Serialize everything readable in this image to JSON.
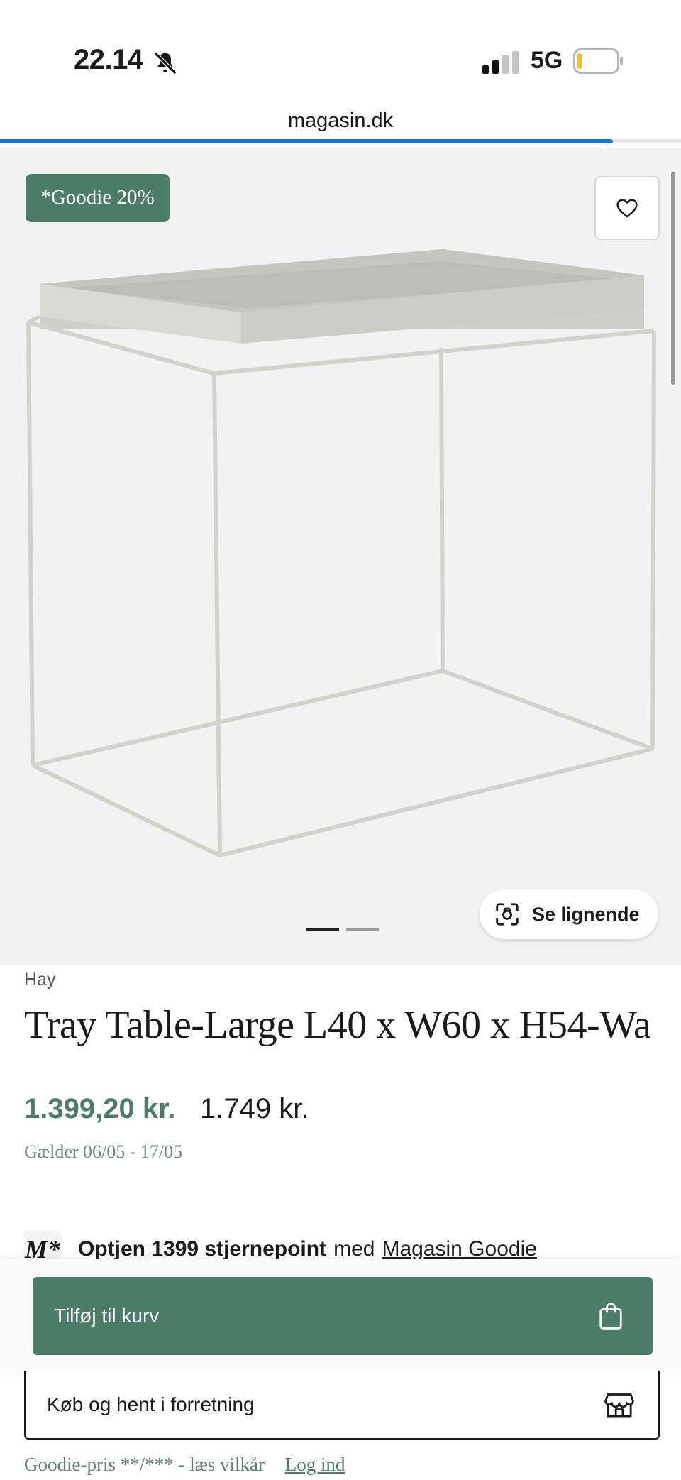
{
  "status_bar": {
    "time": "22.14",
    "network": "5G"
  },
  "browser": {
    "url": "magasin.dk",
    "load_progress_pct": 90
  },
  "product_image": {
    "badge": "*Goodie 20%",
    "similar_button": "Se lignende",
    "carousel": {
      "total": 2,
      "active_index": 0
    }
  },
  "product": {
    "brand": "Hay",
    "title": "Tray Table-Large L40 x W60 x H54-Wa",
    "sale_price": "1.399,20 kr.",
    "original_price": "1.749 kr.",
    "validity": "Gælder 06/05 - 17/05"
  },
  "points": {
    "logo": "M*",
    "bold_text": "Optjen 1399 stjernepoint",
    "plain_text": "med",
    "link_text": "Magasin Goodie"
  },
  "actions": {
    "add_to_cart": "Tilføj til kurv",
    "buy_in_store": "Køb og hent i forretning"
  },
  "footer": {
    "goodie_terms": "Goodie-pris **/*** - læs vilkår",
    "login": "Log ind"
  },
  "colors": {
    "accent": "#4d7c6b",
    "progress": "#1a6fd3",
    "image_bg": "#f2f2f2"
  },
  "icons": [
    "bell-slash-icon",
    "signal-icon",
    "battery-icon",
    "heart-icon",
    "visual-search-icon",
    "shopping-bag-icon",
    "store-icon"
  ]
}
